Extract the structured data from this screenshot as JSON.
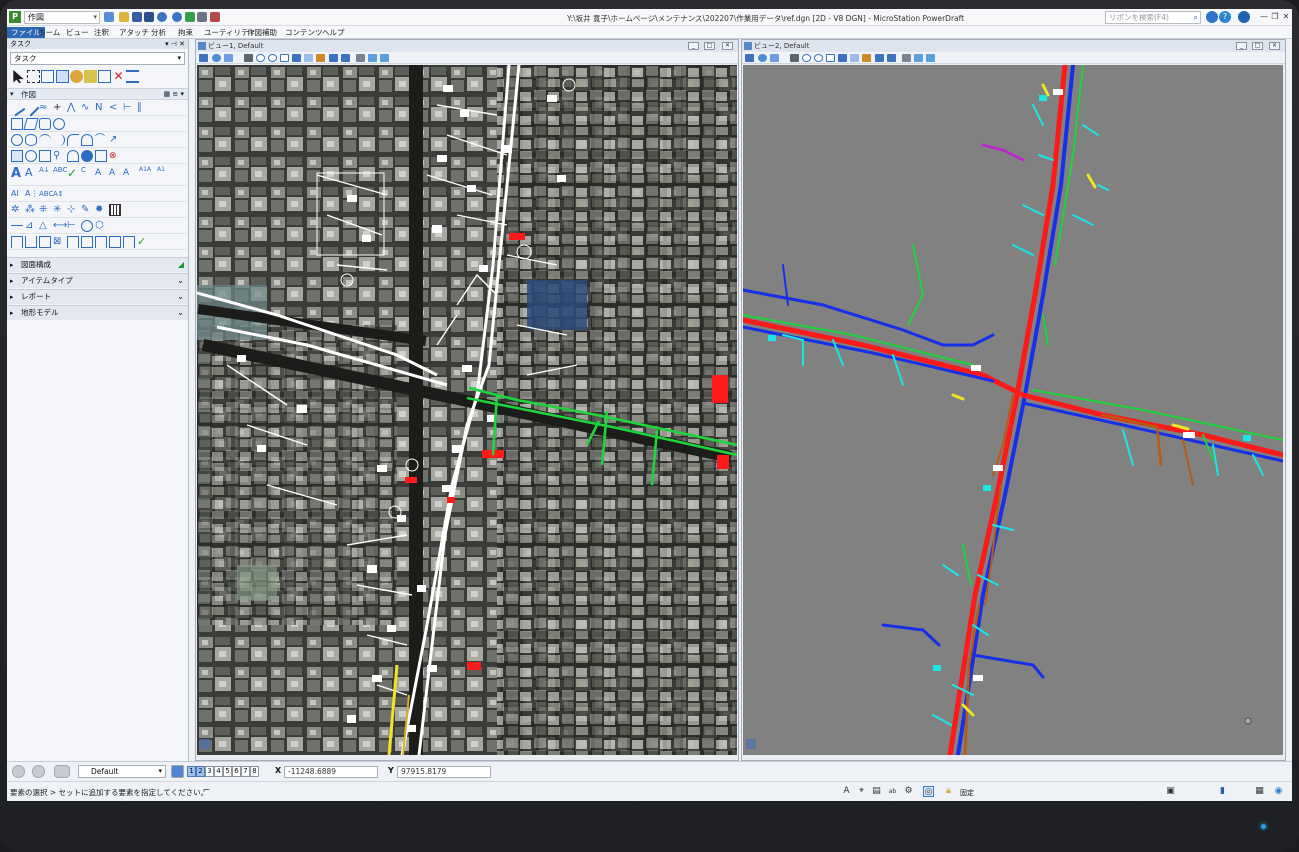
{
  "window": {
    "title": "Y:\\坂井 寛子\\ホームページ\\メンテナンス\\202207\\作業用データ\\ref.dgn [2D - V8 DGN] - MicroStation PowerDraft",
    "workflow": "作図",
    "ribbon_search_placeholder": "リボンを検索(F4)"
  },
  "ribbon": {
    "tabs": [
      "ファイル",
      "ホーム",
      "ビュー",
      "注釈",
      "アタッチ",
      "分析",
      "拘束",
      "ユーティリティ",
      "作図補助",
      "コンテンツ",
      "ヘルプ"
    ],
    "active_tab": "ファイル"
  },
  "task_panel": {
    "title": "タスク",
    "task_select_value": "タスク",
    "sections": {
      "drawing": "作図",
      "collapsed": [
        "図面構成",
        "アイテムタイプ",
        "レポート",
        "地形モデル"
      ]
    }
  },
  "view1": {
    "title": "ビュー1, Default"
  },
  "view2": {
    "title": "ビュー2, Default"
  },
  "statusbar": {
    "level": "Default",
    "view_numbers": [
      "1",
      "2",
      "3",
      "4",
      "5",
      "6",
      "7",
      "8"
    ],
    "active_views": [
      1,
      2
    ],
    "x_label": "X",
    "x_value": "-11248.6889",
    "y_label": "Y",
    "y_value": "97915.8179",
    "prompt": "要素の選択 > セットに追加する要素を指定してください。",
    "lock_label": "固定"
  },
  "colors": {
    "accent": "#2b67b5",
    "pipe_red": "#ff1a1a",
    "pipe_blue": "#1530e8",
    "pipe_green": "#1fd43a",
    "pipe_cyan": "#19e6e6",
    "pipe_yellow": "#f1e425",
    "pipe_brown": "#b85a12",
    "pipe_magenta": "#c21dd8"
  }
}
